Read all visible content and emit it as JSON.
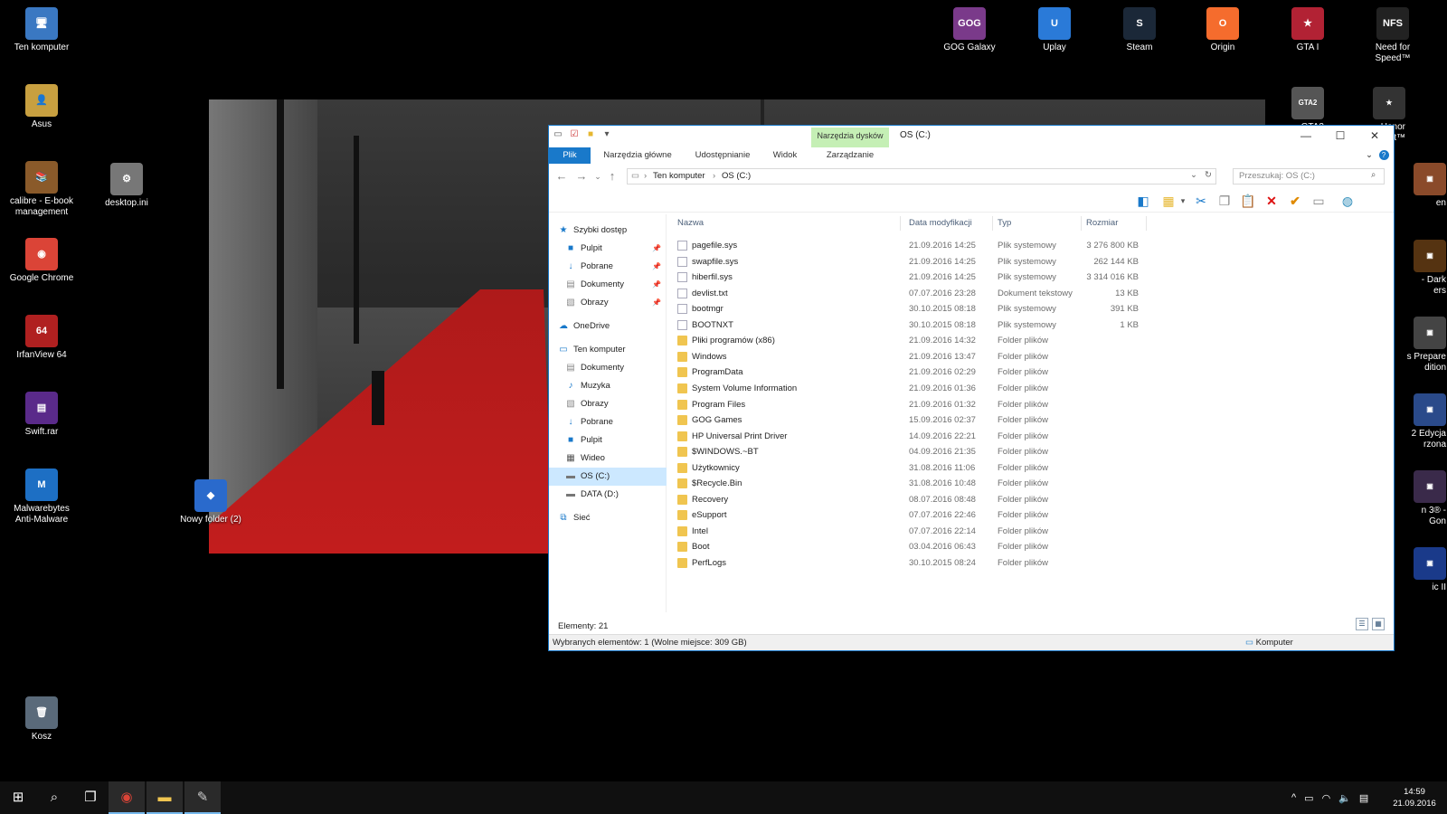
{
  "desktop": {
    "left_icons": [
      {
        "label": "Ten komputer",
        "glyph": "🖥",
        "color": "#3a78c2"
      },
      {
        "label": "Asus",
        "glyph": "👤",
        "color": "#c8a040"
      },
      {
        "label": "calibre - E-book management",
        "glyph": "📚",
        "color": "#8a5a2a"
      },
      {
        "label": "Google Chrome",
        "glyph": "◉",
        "color": "#db4437"
      },
      {
        "label": "IrfanView 64",
        "glyph": "64",
        "color": "#b02020"
      },
      {
        "label": "Swift.rar",
        "glyph": "▤",
        "color": "#5a2a8a"
      },
      {
        "label": "Malwarebytes Anti-Malware",
        "glyph": "M",
        "color": "#1d6fc4"
      },
      {
        "label": "Kosz",
        "glyph": "🗑",
        "color": "#5a6a7a"
      }
    ],
    "desktop_ini": {
      "label": "desktop.ini",
      "glyph": "⚙",
      "color": "#777777"
    },
    "new_folder": {
      "label": "Nowy folder (2)",
      "glyph": "◆",
      "color": "#2a6acc"
    },
    "top_icons": [
      {
        "label": "GOG Galaxy",
        "glyph": "GOG",
        "color": "#7a3a8a"
      },
      {
        "label": "Uplay",
        "glyph": "U",
        "color": "#2a7ad8"
      },
      {
        "label": "Steam",
        "glyph": "S",
        "color": "#1b2838"
      },
      {
        "label": "Origin",
        "glyph": "O",
        "color": "#f56c2d"
      },
      {
        "label": "GTA I",
        "glyph": "★",
        "color": "#b22234"
      },
      {
        "label": "Need for Speed™",
        "glyph": "NFS",
        "color": "#222222"
      }
    ],
    "right_partial": [
      {
        "label": "GTA2",
        "glyph": "GTA2",
        "color": "#555555"
      },
      {
        "label": "Honor\nssault™",
        "glyph": "★",
        "color": "#333333"
      },
      {
        "label": "en",
        "glyph": "▣",
        "color": "#8a4a2a"
      },
      {
        "label": "- Dark\ners",
        "glyph": "▣",
        "color": "#553311"
      },
      {
        "label": "s Prepare\ndition",
        "glyph": "▣",
        "color": "#444444"
      },
      {
        "label": "2 Edycja\nrzona",
        "glyph": "▣",
        "color": "#2a4a8a"
      },
      {
        "label": "n 3® -\nGon",
        "glyph": "▣",
        "color": "#3a2a4a"
      },
      {
        "label": "ic II",
        "glyph": "▣",
        "color": "#1a3a8a"
      }
    ]
  },
  "window": {
    "title": "OS (C:)",
    "context_tab": "Narzędzia dysków",
    "tabs": [
      "Plik",
      "Narzędzia główne",
      "Udostępnianie",
      "Widok",
      "Zarządzanie"
    ],
    "breadcrumb": [
      "Ten komputer",
      "OS (C:)"
    ],
    "search_placeholder": "Przeszukaj: OS (C:)",
    "nav": {
      "quick_access": "Szybki dostęp",
      "quick_items": [
        "Pulpit",
        "Pobrane",
        "Dokumenty",
        "Obrazy"
      ],
      "onedrive": "OneDrive",
      "this_pc": "Ten komputer",
      "pc_items": [
        "Dokumenty",
        "Muzyka",
        "Obrazy",
        "Pobrane",
        "Pulpit",
        "Wideo",
        "OS (C:)",
        "DATA (D:)"
      ],
      "network": "Sieć"
    },
    "columns": [
      "Nazwa",
      "Data modyfikacji",
      "Typ",
      "Rozmiar"
    ],
    "files": [
      {
        "name": "pagefile.sys",
        "date": "21.09.2016 14:25",
        "type": "Plik systemowy",
        "size": "3 276 800 KB",
        "kind": "file"
      },
      {
        "name": "swapfile.sys",
        "date": "21.09.2016 14:25",
        "type": "Plik systemowy",
        "size": "262 144 KB",
        "kind": "file"
      },
      {
        "name": "hiberfil.sys",
        "date": "21.09.2016 14:25",
        "type": "Plik systemowy",
        "size": "3 314 016 KB",
        "kind": "file"
      },
      {
        "name": "devlist.txt",
        "date": "07.07.2016 23:28",
        "type": "Dokument tekstowy",
        "size": "13 KB",
        "kind": "file"
      },
      {
        "name": "bootmgr",
        "date": "30.10.2015 08:18",
        "type": "Plik systemowy",
        "size": "391 KB",
        "kind": "file"
      },
      {
        "name": "BOOTNXT",
        "date": "30.10.2015 08:18",
        "type": "Plik systemowy",
        "size": "1 KB",
        "kind": "file"
      },
      {
        "name": "Pliki programów (x86)",
        "date": "21.09.2016 14:32",
        "type": "Folder plików",
        "size": "",
        "kind": "folder"
      },
      {
        "name": "Windows",
        "date": "21.09.2016 13:47",
        "type": "Folder plików",
        "size": "",
        "kind": "folder"
      },
      {
        "name": "ProgramData",
        "date": "21.09.2016 02:29",
        "type": "Folder plików",
        "size": "",
        "kind": "folder"
      },
      {
        "name": "System Volume Information",
        "date": "21.09.2016 01:36",
        "type": "Folder plików",
        "size": "",
        "kind": "folder"
      },
      {
        "name": "Program Files",
        "date": "21.09.2016 01:32",
        "type": "Folder plików",
        "size": "",
        "kind": "folder"
      },
      {
        "name": "GOG Games",
        "date": "15.09.2016 02:37",
        "type": "Folder plików",
        "size": "",
        "kind": "folder"
      },
      {
        "name": "HP Universal Print Driver",
        "date": "14.09.2016 22:21",
        "type": "Folder plików",
        "size": "",
        "kind": "folder"
      },
      {
        "name": "$WINDOWS.~BT",
        "date": "04.09.2016 21:35",
        "type": "Folder plików",
        "size": "",
        "kind": "folder"
      },
      {
        "name": "Użytkownicy",
        "date": "31.08.2016 11:06",
        "type": "Folder plików",
        "size": "",
        "kind": "folder"
      },
      {
        "name": "$Recycle.Bin",
        "date": "31.08.2016 10:48",
        "type": "Folder plików",
        "size": "",
        "kind": "folder"
      },
      {
        "name": "Recovery",
        "date": "08.07.2016 08:48",
        "type": "Folder plików",
        "size": "",
        "kind": "folder"
      },
      {
        "name": "eSupport",
        "date": "07.07.2016 22:46",
        "type": "Folder plików",
        "size": "",
        "kind": "folder"
      },
      {
        "name": "Intel",
        "date": "07.07.2016 22:14",
        "type": "Folder plików",
        "size": "",
        "kind": "folder"
      },
      {
        "name": "Boot",
        "date": "03.04.2016 06:43",
        "type": "Folder plików",
        "size": "",
        "kind": "folder"
      },
      {
        "name": "PerfLogs",
        "date": "30.10.2015 08:24",
        "type": "Folder plików",
        "size": "",
        "kind": "folder"
      }
    ],
    "item_count": "Elementy: 21",
    "status": "Wybranych elementów: 1 (Wolne miejsce: 309 GB)",
    "status_right": "Komputer"
  },
  "taskbar": {
    "time": "14:59",
    "date": "21.09.2016"
  }
}
